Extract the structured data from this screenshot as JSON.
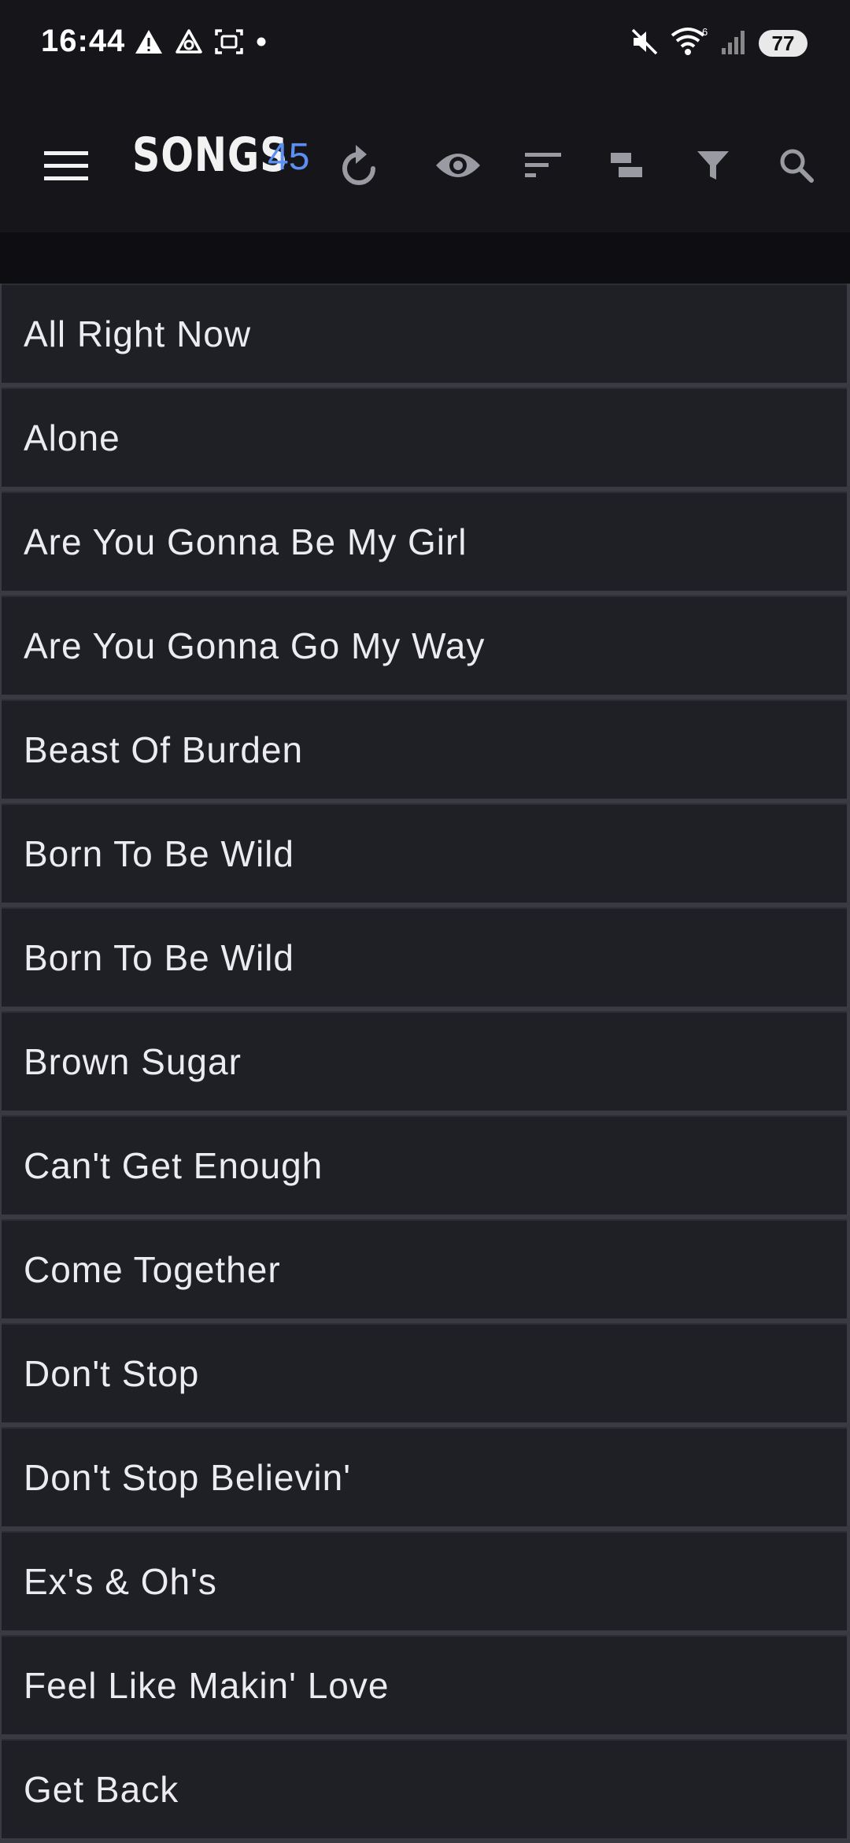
{
  "status_bar": {
    "time": "16:44",
    "battery": "77",
    "icons_left": [
      "warning-icon",
      "recycle-icon",
      "screenshot-icon",
      "dot-icon"
    ],
    "icons_right": [
      "mute-icon",
      "wifi-icon",
      "signal-icon",
      "battery-icon"
    ]
  },
  "toolbar": {
    "title": "SONGS",
    "count": "45",
    "count_color": "#5b8ff0",
    "icons": [
      "menu-icon",
      "refresh-icon",
      "eye-icon",
      "sort-icon",
      "layout-icon",
      "filter-icon",
      "search-icon"
    ]
  },
  "songs": [
    "All Right Now",
    "Alone",
    "Are You Gonna Be My Girl",
    "Are You Gonna Go My Way",
    "Beast Of Burden",
    "Born To Be Wild",
    "Born To Be Wild",
    "Brown Sugar",
    "Can't Get Enough",
    "Come Together",
    "Don't Stop",
    "Don't Stop Believin'",
    "Ex's & Oh's",
    "Feel Like Makin' Love",
    "Get Back"
  ]
}
